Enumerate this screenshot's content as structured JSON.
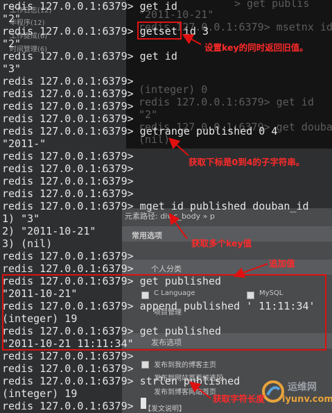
{
  "terminal": {
    "lines": [
      "redis 127.0.0.1:6379> get id",
      "\"2\"",
      "redis 127.0.0.1:6379> getset id 3",
      "\"2\"",
      "redis 127.0.0.1:6379> get id",
      "\"3\"",
      "redis 127.0.0.1:6379>",
      "redis 127.0.0.1:6379>",
      "redis 127.0.0.1:6379>",
      "redis 127.0.0.1:6379>",
      "redis 127.0.0.1:6379> getrange published 0 4",
      "\"2011-\"",
      "redis 127.0.0.1:6379>",
      "redis 127.0.0.1:6379>",
      "redis 127.0.0.1:6379>",
      "redis 127.0.0.1:6379>",
      "redis 127.0.0.1:6379> mget id published douban_id",
      "1) \"3\"",
      "2) \"2011-10-21\"",
      "3) (nil)",
      "redis 127.0.0.1:6379>",
      "redis 127.0.0.1:6379>",
      "redis 127.0.0.1:6379> get published",
      "\"2011-10-21\"",
      "redis 127.0.0.1:6379> append published ' 11:11:34'",
      "(integer) 19",
      "redis 127.0.0.1:6379> get published",
      "\"2011-10-21 11:11:34\"",
      "redis 127.0.0.1:6379>",
      "redis 127.0.0.1:6379>",
      "redis 127.0.0.1:6379> strlen published",
      "(integer) 19",
      "redis 127.0.0.1:6379>"
    ]
  },
  "annotations": {
    "getset": "设置key的同时返回旧值。",
    "getrange": "获取下标是0到4的子字符串。",
    "mget": "获取多个key值",
    "append": "追加值",
    "strlen": "获取字符长度"
  },
  "background": {
    "topleft": [
      "工作日志(12)",
      "毕程序(12)",
      "工作提成(6)",
      "时间管理(6)"
    ],
    "ghost_lines": [
      "> get publis",
      "\"2011-10-21\"",
      "redis 127.0.0.1:6379> msetnx id",
      "(integer) 0",
      "redis 127.0.0.1:6379> get id",
      "\"2\"",
      "redis 127.0.0.1:6379> get douban",
      "(nil)"
    ],
    "breadcrumb": "元素路径: div.c_body » p",
    "common_options": "常用选项",
    "personal_category": "个人分类",
    "category_c": "C Language",
    "category_mysql": "MySQL",
    "project_mgmt": "项目管理",
    "publish_options": "发布选项",
    "publish_home": "发布到我的博客主页",
    "publish_site": "发布到网站首页候选区",
    "publish_group": "发布到博客网站首页",
    "post_note": "【发文说明】",
    "watermark_cn": "运维网",
    "watermark_url": "iyunv.com"
  },
  "colors": {
    "annotation": "#e01010",
    "terminal_text": "#e6e6e6",
    "background": "#2e2f31"
  }
}
